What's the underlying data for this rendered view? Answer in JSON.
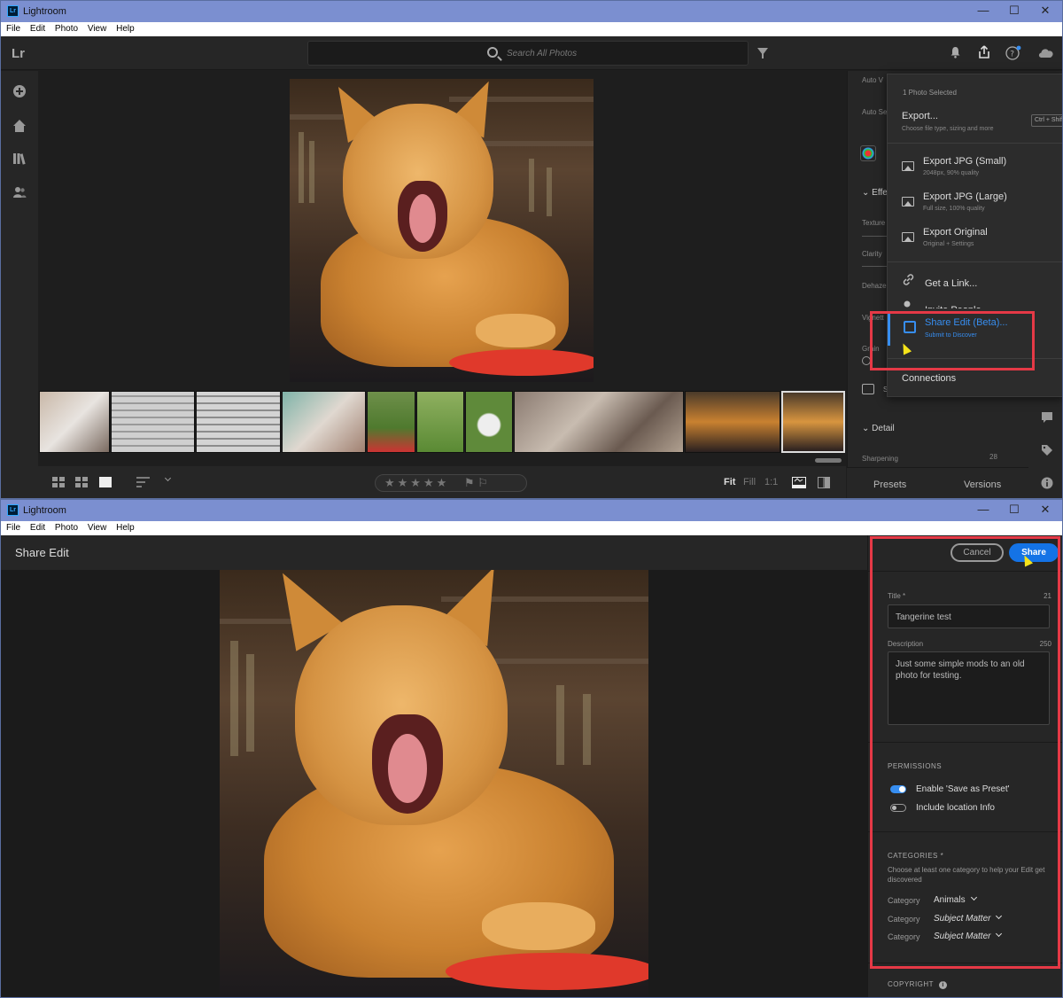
{
  "app": {
    "title": "Lightroom",
    "logo": "Lr",
    "badge": "Lr",
    "win_min": "—",
    "win_max": "☐",
    "win_close": "✕"
  },
  "menu": [
    "File",
    "Edit",
    "Photo",
    "View",
    "Help"
  ],
  "search": {
    "placeholder": "Search All Photos"
  },
  "edit_panel": {
    "labels": [
      "Auto V",
      "Auto Se",
      "Effe",
      "Texture",
      "Clarity",
      "Dehaze",
      "Vignett",
      "Grain",
      "S"
    ],
    "detail": "Detail",
    "sharpening": "Sharpening",
    "sharpening_value": "28"
  },
  "bottom": {
    "fit": "Fit",
    "fill": "Fill",
    "ratio": "1:1",
    "stars": "★★★★★"
  },
  "tabs": {
    "presets": "Presets",
    "versions": "Versions"
  },
  "share_menu": {
    "header": "1 Photo Selected",
    "export_title": "Export...",
    "export_sub": "Choose file type, sizing and more",
    "export_shortcut": "Ctrl + Shift",
    "items": [
      {
        "title": "Export JPG (Small)",
        "sub": "2048px, 90% quality"
      },
      {
        "title": "Export JPG (Large)",
        "sub": "Full size, 100% quality"
      },
      {
        "title": "Export Original",
        "sub": "Original + Settings"
      }
    ],
    "get_link": "Get a Link...",
    "invite": "Invite People...",
    "share_edit": "Share Edit (Beta)...",
    "share_edit_sub": "Submit to Discover",
    "connections": "Connections"
  },
  "share_edit": {
    "window_title": "Share Edit",
    "cancel": "Cancel",
    "share": "Share",
    "title_label": "Title *",
    "title_count": "21",
    "title_value": "Tangerine test",
    "description_label": "Description",
    "description_count": "250",
    "description_value": "Just some simple mods to an old photo for testing.",
    "permissions_heading": "PERMISSIONS",
    "perm_preset": "Enable 'Save as Preset'",
    "perm_preset_on": true,
    "perm_location": "Include location Info",
    "perm_location_on": false,
    "categories_heading": "CATEGORIES *",
    "categories_help": "Choose at least one category to help your Edit get discovered",
    "categories": [
      {
        "label": "Category",
        "value": "Animals"
      },
      {
        "label": "Category",
        "value": "Subject Matter"
      },
      {
        "label": "Category",
        "value": "Subject Matter"
      }
    ],
    "copyright_heading": "COPYRIGHT",
    "info_glyph": "i"
  },
  "colors": {
    "accent": "#378ef0",
    "share_button": "#1473e6",
    "highlight": "#e53946",
    "titlebar": "#7b8fd0"
  },
  "icons": [
    "add-photos-icon",
    "home-icon",
    "library-icon",
    "people-icon",
    "bell-icon",
    "share-icon",
    "help-icon",
    "cloud-icon",
    "filter-icon",
    "search-icon",
    "comment-icon",
    "tag-icon",
    "info-icon"
  ]
}
